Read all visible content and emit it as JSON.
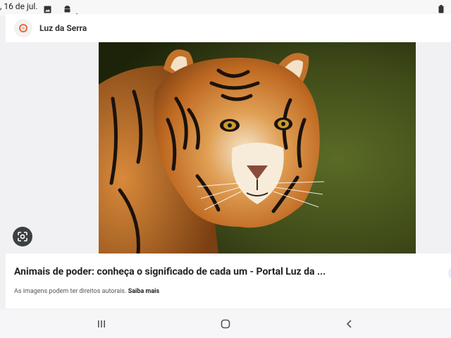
{
  "status_bar": {
    "date": ", 16 de jul.",
    "icons": [
      "image-icon",
      "android-icon",
      "dot-icon",
      "battery-icon"
    ]
  },
  "result": {
    "source_name": "Luz da Serra",
    "title": "Animais de poder: conheça o significado de cada um - Portal Luz da ...",
    "notice": "As imagens podem ter direitos autorais.",
    "notice_link": "Saiba mais"
  },
  "nav_bar": {
    "buttons": [
      "recents-icon",
      "home-icon",
      "back-icon"
    ]
  },
  "colors": {
    "brand_accent": "#e86a3c",
    "lens_button": "#3c4043"
  }
}
